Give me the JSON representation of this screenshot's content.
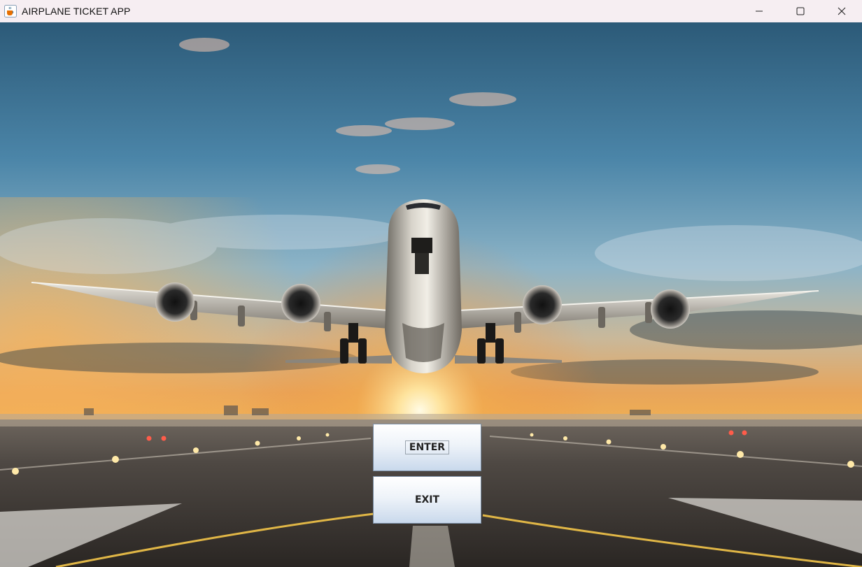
{
  "window": {
    "title": "AIRPLANE TICKET APP",
    "icons": {
      "app": "java-cup-icon",
      "minimize": "minimize-icon",
      "maximize": "maximize-icon",
      "close": "close-icon"
    }
  },
  "background": {
    "description_icon": "airplane-runway-sunset-image"
  },
  "buttons": {
    "enter_label": "ENTER",
    "exit_label": "EXIT"
  },
  "colors": {
    "titlebar_bg": "#f6eef2",
    "button_top": "#ffffff",
    "button_bottom": "#c9d9ec",
    "button_border": "#7a8ea5"
  }
}
